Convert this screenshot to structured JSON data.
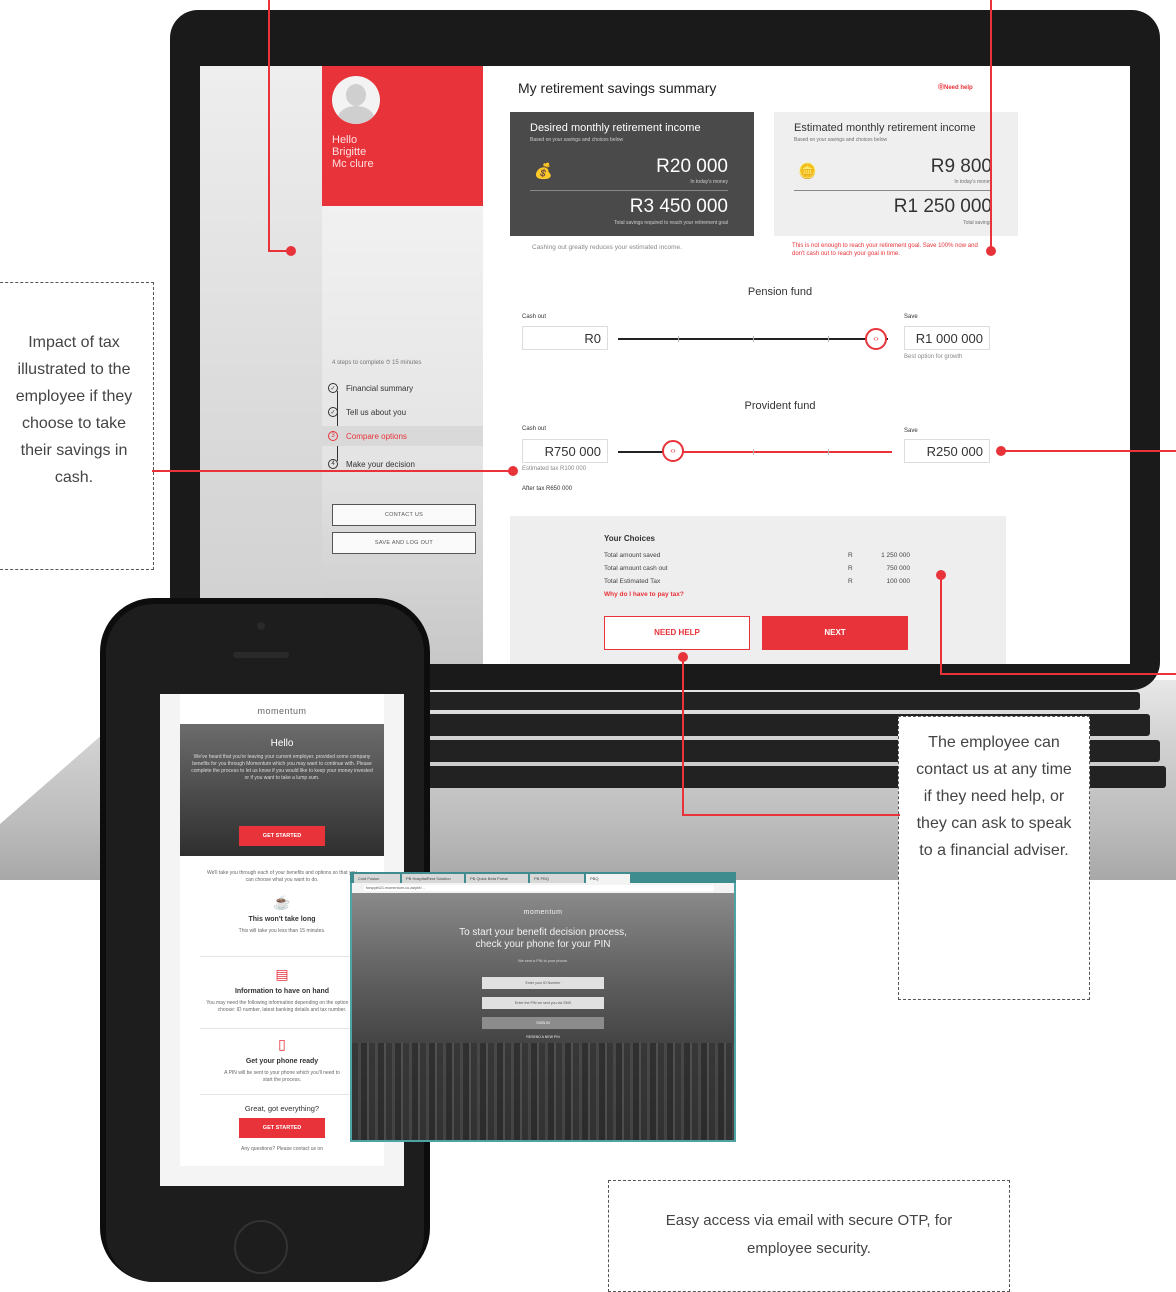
{
  "laptop": {
    "sidebar": {
      "greeting": [
        "Hello",
        "Brigitte",
        "Mc clure"
      ],
      "steps_meta": "4 steps to complete   ⏱ 15 minutes",
      "steps": [
        {
          "number": "1",
          "label": "Financial summary",
          "state": "done"
        },
        {
          "number": "2",
          "label": "Tell us about you",
          "state": "done"
        },
        {
          "number": "3",
          "label": "Compare options",
          "state": "active"
        },
        {
          "number": "4",
          "label": "Make your decision",
          "state": "todo"
        }
      ],
      "contact_button": "CONTACT US",
      "save_button": "SAVE AND LOG OUT"
    },
    "main": {
      "title": "My retirement savings summary",
      "need_help_link": "⓪Need help",
      "desired": {
        "title": "Desired monthly retirement income",
        "subtitle": "Based on your savings and choices below",
        "amount": "R20 000",
        "amount_caption": "In today's money",
        "total": "R3 450 000",
        "total_caption": "Total savings required to reach your retirement goal",
        "icon": "money-bag-icon"
      },
      "estimated": {
        "title": "Estimated monthly retirement income",
        "subtitle": "Based on your savings and choices below",
        "amount": "R9 800",
        "amount_caption": "In today's money",
        "total": "R1 250 000",
        "total_caption": "Total savings",
        "icon": "coins-icon"
      },
      "note_left": "Cashing out greatly reduces your estimated income.",
      "note_right": "This is not enough to reach your retirement goal. Save 100% now and don't cash out to reach your goal in time.",
      "pension": {
        "title": "Pension fund",
        "cash_out_label": "Cash out",
        "cash_out_value": "R0",
        "save_label": "Save",
        "save_value": "R1 000 000",
        "save_caption": "Best option for growth",
        "slider_position": 1.0
      },
      "provident": {
        "title": "Provident fund",
        "cash_out_label": "Cash out",
        "cash_out_value": "R750 000",
        "tax_caption": "Estimated tax R100 000",
        "after_tax": "After tax R650 000",
        "save_label": "Save",
        "save_value": "R250 000",
        "slider_position": 0.2
      },
      "choices": {
        "title": "Your Choices",
        "rows": [
          {
            "label": "Total amount saved",
            "currency": "R",
            "value": "1 250 000"
          },
          {
            "label": "Total amount cash out",
            "currency": "R",
            "value": "750 000"
          },
          {
            "label": "Total Estimated Tax",
            "currency": "R",
            "value": "100 000"
          }
        ],
        "why_link": "Why do I have to pay tax?",
        "need_help_button": "NEED HELP",
        "next_button": "NEXT"
      }
    }
  },
  "annotations": {
    "tax": "Impact of tax illustrated to the employee if they choose to take their savings in cash.",
    "contact": "The employee can contact us at any time if they need help, or they can ask to speak to a financial adviser.",
    "email": "Easy access via email with secure OTP, for employee security."
  },
  "phone": {
    "logo": "momentum",
    "hello": "Hello",
    "intro": "We've heard that you're leaving your current employer. provided some company benefits for you through Momentum which you may want to continue with. Please complete the process to let us know if you would like to keep your money invested or if you want to take a lump sum.",
    "get_started": "GET STARTED",
    "walkthrough": "We'll take you through each of your benefits and options so that you can choose what you want to do.",
    "items": [
      {
        "icon": "cup-icon",
        "title": "This won't take long",
        "text": "This will take you less than 15 minutes."
      },
      {
        "icon": "document-icon",
        "title": "Information to have on hand",
        "text": "You may need the following information depending on the option you choose: ID number, latest banking details and tax number."
      },
      {
        "icon": "phone-icon",
        "title": "Get your phone ready",
        "text": "A PIN will be sent to your phone which you'll need to start the process."
      }
    ],
    "ready": "Great, got everything?",
    "get_started_2": "GET STARTED",
    "questions": "Any questions? Please contact us on"
  },
  "browser": {
    "tabs": [
      "Cold Fusion",
      "PB HospitalRest Solution",
      "PB Quick Beta Portal",
      "PB PBQ",
      "PBQ"
    ],
    "url": "forsppth21.momentum.co.za/pbf/...",
    "logo": "momentum",
    "headline": "To start your benefit decision process, check your phone for your PIN",
    "sub": "We sent a PIN to your phone.",
    "id_placeholder": "Enter your ID Number",
    "pin_placeholder": "Enter the PIN we sent you via SMS",
    "sign_in": "SIGN IN",
    "resend": "RESEND A NEW PIN",
    "accent": "#e8333a"
  }
}
